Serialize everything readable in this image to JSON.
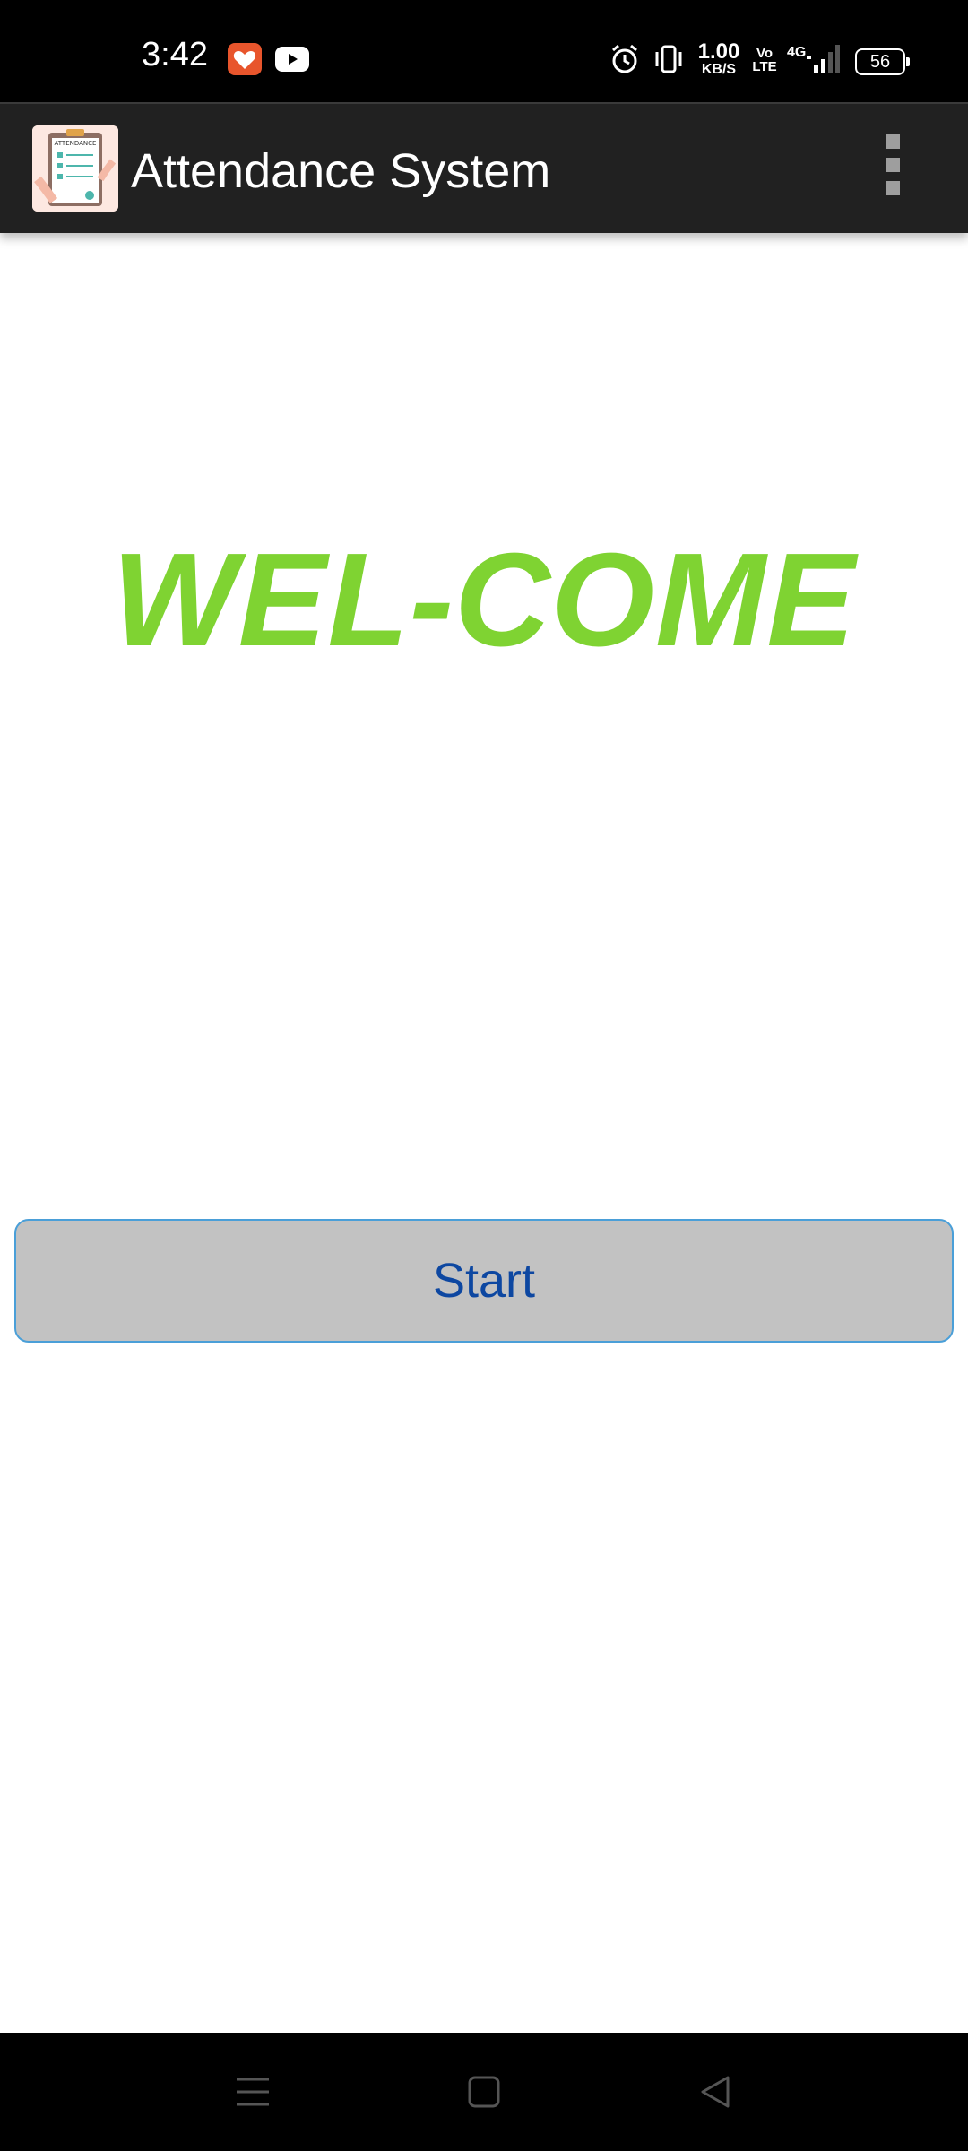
{
  "status_bar": {
    "time": "3:42",
    "notifications": [
      "health-icon",
      "youtube-icon"
    ],
    "net_speed_value": "1.00",
    "net_speed_unit": "KB/S",
    "volte_top": "Vo",
    "volte_bottom": "LTE",
    "network": "4G",
    "battery": "56"
  },
  "app_bar": {
    "title": "Attendance System",
    "logo_text": "ATTENDANCE"
  },
  "main": {
    "welcome_text": "WEL-COME",
    "start_label": "Start"
  },
  "colors": {
    "welcome": "#7fd332",
    "button_bg": "#c2c2c2",
    "button_text": "#0d47a1",
    "button_border": "#4a9fd8",
    "app_bar": "#212121"
  }
}
